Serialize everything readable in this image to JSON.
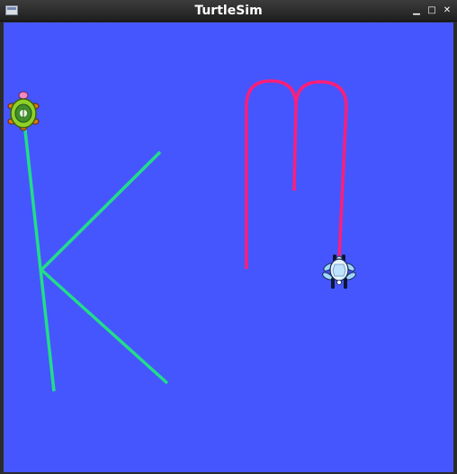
{
  "window": {
    "title": "TurtleSim",
    "minimize_glyph": "▁",
    "maximize_glyph": "□",
    "close_glyph": "✕"
  },
  "canvas": {
    "background_color": "#4556ff"
  },
  "turtles": [
    {
      "name": "turtle1",
      "icon": "green-turtle-icon",
      "heading": "down"
    },
    {
      "name": "turtle2",
      "icon": "light-blue-turtle-icon",
      "heading": "up"
    }
  ],
  "trails": [
    {
      "owner": "turtle1",
      "shape": "K",
      "color": "#22dd88"
    },
    {
      "owner": "turtle2",
      "shape": "m",
      "color": "#ff1e78"
    }
  ]
}
